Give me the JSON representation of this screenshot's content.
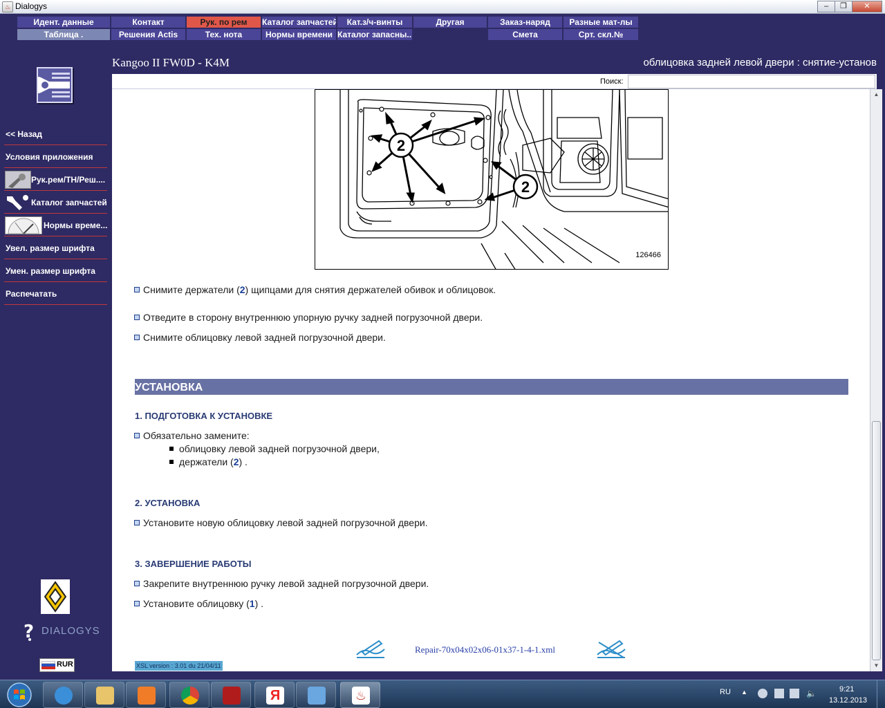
{
  "window": {
    "title": "Dialogys",
    "min": "‒",
    "max": "❐",
    "close": "✕"
  },
  "menu": {
    "row1": [
      "Идент. данные",
      "Контакт",
      "Рук. по рем",
      "Каталог запчастей",
      "Кат.з/ч-винты",
      "Другая",
      "Заказ-наряд",
      "Разные мат-лы"
    ],
    "row2": [
      "Таблица .",
      "Решения Actis",
      "Тех. нота",
      "Нормы времени",
      "Каталог запасны...",
      "Смета",
      "Срт. скл.№"
    ],
    "active": "Рук. по рем"
  },
  "header": {
    "model": "Kangoo II FW0D - K4M",
    "operation": "облицовка задней левой двери : снятие-установ"
  },
  "search": {
    "label": "Поиск:",
    "value": ""
  },
  "sidebar": {
    "items": [
      "<< Назад",
      "Условия приложения",
      "Рук.рем/ТН/Реш....",
      "Каталог запчастей",
      "Нормы време...",
      "Увел. размер шрифта",
      "Умен. размер шрифта",
      "Распечатать"
    ],
    "brand": "DIALOGYS",
    "currency": "RUR"
  },
  "figure": {
    "number": "126466",
    "callout": "2"
  },
  "content": {
    "removal_steps": [
      {
        "pre": "Снимите держатели (",
        "ref": "2",
        "post": ") щипцами для снятия держателей обивок и облицовок."
      },
      {
        "pre": "Отведите в сторону внутреннюю упорную ручку задней погрузочной двери.",
        "ref": "",
        "post": ""
      },
      {
        "pre": "Снимите облицовку левой задней погрузочной двери.",
        "ref": "",
        "post": ""
      }
    ],
    "section_title": "УСТАНОВКА",
    "step1": {
      "heading": "1. ПОДГОТОВКА К УСТАНОВКЕ",
      "text": "Обязательно замените:",
      "items": [
        {
          "pre": "облицовку левой задней погрузочной двери,",
          "ref": "",
          "post": ""
        },
        {
          "pre": "держатели (",
          "ref": "2",
          "post": ") ."
        }
      ]
    },
    "step2": {
      "heading": "2. УСТАНОВКА",
      "text": "Установите новую облицовку левой задней погрузочной двери."
    },
    "step3": {
      "heading": "3. ЗАВЕРШЕНИЕ РАБОТЫ",
      "items": [
        {
          "pre": "Закрепите внутреннюю ручку левой задней погрузочной двери.",
          "ref": "",
          "post": ""
        },
        {
          "pre": "Установите облицовку (",
          "ref": "1",
          "post": ") ."
        }
      ]
    }
  },
  "footer": {
    "file": "Repair-70x04x02x06-01x37-1-4-1.xml",
    "xsl": "XSL version : 3.01 du 21/04/11"
  },
  "taskbar": {
    "lang": "RU",
    "time": "9:21",
    "date": "13.12.2013"
  },
  "colors": {
    "background": "#2e2a63",
    "menu_blue": "#4a4596",
    "menu_grey": "#7d87b3",
    "menu_active": "#e0574a",
    "section_band": "#6771a3",
    "heading": "#283a74",
    "separator": "#c0393d"
  }
}
